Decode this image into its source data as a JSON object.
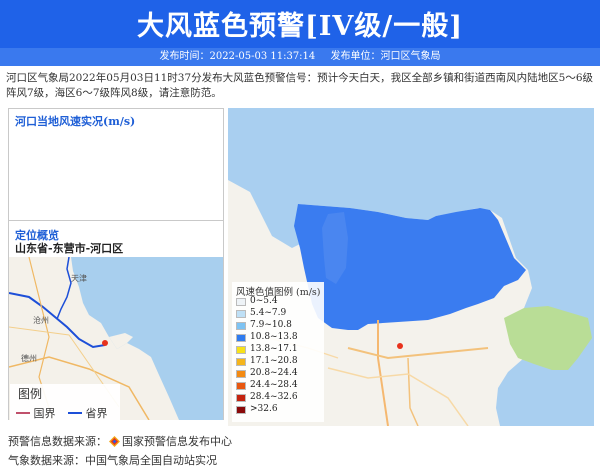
{
  "header": {
    "title": "大风蓝色预警[IV级/一般]",
    "publish_time": "发布时间：2022-05-03 11:37:14",
    "publisher": "发布单位：河口区气象局"
  },
  "description": "河口区气象局2022年05月03日11时37分发布大风蓝色预警信号：预计今天白天，我区全部乡镇和街道西南风内陆地区5～6级阵风7级，海区6～7级阵风8级，请注意防范。",
  "wind_panel": {
    "title": "河口当地风速实况(m/s)"
  },
  "location": {
    "title": "定位概览",
    "path": "山东省-东营市-河口区"
  },
  "minimap": {
    "labels": [
      "天津",
      "沧州",
      "德州"
    ],
    "legend_title": "图例",
    "legend_items": [
      {
        "label": "国界",
        "color": "#c0506b"
      },
      {
        "label": "省界",
        "color": "#1d4fd8"
      }
    ]
  },
  "wind_legend": {
    "title": "风速色值图例 (m/s)",
    "items": [
      {
        "label": "0~5.4",
        "color": "#eef3f7"
      },
      {
        "label": "5.4~7.9",
        "color": "#bfe0f6"
      },
      {
        "label": "7.9~10.8",
        "color": "#7ec3f3"
      },
      {
        "label": "10.8~13.8",
        "color": "#2f7cf0"
      },
      {
        "label": "13.8~17.1",
        "color": "#f7e11a"
      },
      {
        "label": "17.1~20.8",
        "color": "#f5b51c"
      },
      {
        "label": "20.8~24.4",
        "color": "#f38a12"
      },
      {
        "label": "24.4~28.4",
        "color": "#e8570f"
      },
      {
        "label": "28.4~32.6",
        "color": "#c4230f"
      },
      {
        "label": ">32.6",
        "color": "#8a0a0a"
      }
    ]
  },
  "sources": {
    "warning": "预警信息数据来源：",
    "warning_org": "国家预警信息发布中心",
    "weather": "气象数据来源：中国气象局全国自动站实况"
  }
}
